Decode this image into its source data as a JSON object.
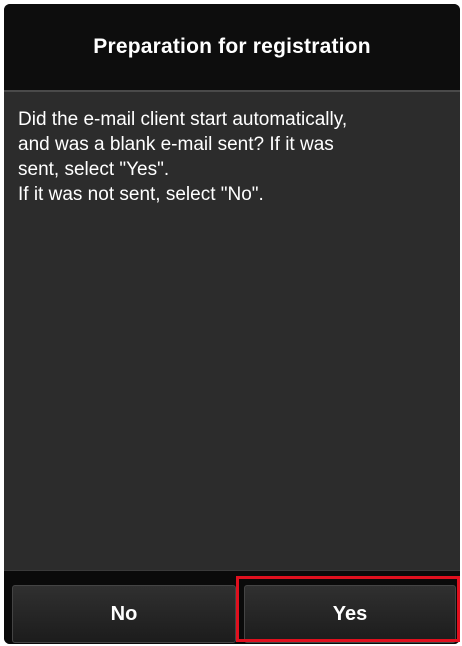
{
  "dialog": {
    "title": "Preparation for registration",
    "message": "Did the e-mail client start automatically,\nand was a blank e-mail sent? If it was\nsent, select \"Yes\".\nIf it was not sent, select \"No\"."
  },
  "buttons": {
    "no_label": "No",
    "yes_label": "Yes"
  },
  "highlight": {
    "target": "yes-button",
    "color": "#e0101e"
  }
}
